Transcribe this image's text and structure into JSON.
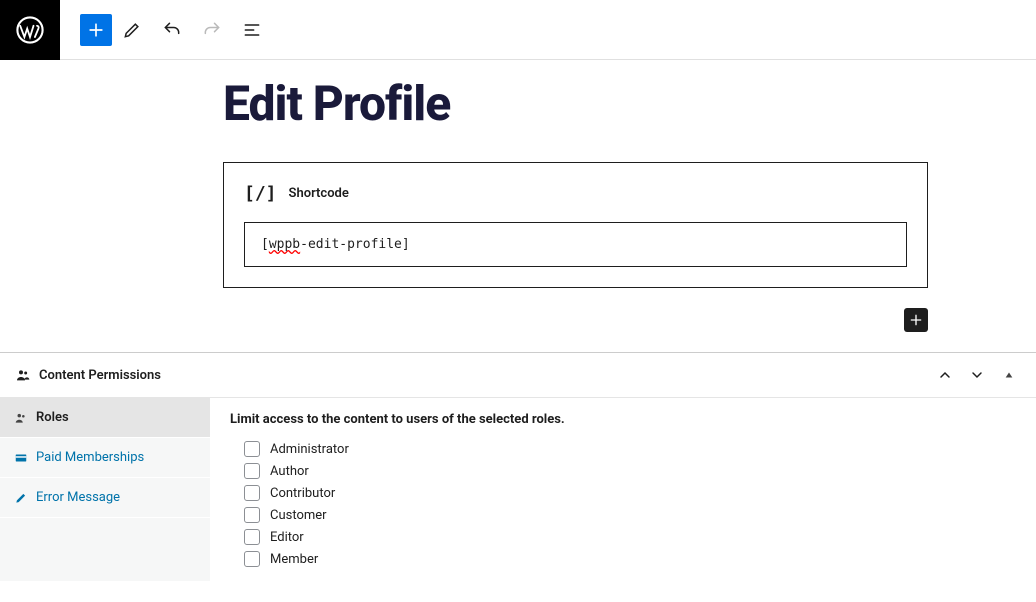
{
  "editor": {
    "page_title": "Edit Profile",
    "shortcode_block": {
      "label": "Shortcode",
      "value_prefix": "[",
      "value_spell": "wppb",
      "value_suffix": "-edit-profile]"
    }
  },
  "permissions": {
    "title": "Content Permissions",
    "sidebar": {
      "roles_label": "Roles",
      "paid_memberships_label": "Paid Memberships",
      "error_message_label": "Error Message"
    },
    "instruction": "Limit access to the content to users of the selected roles.",
    "roles": [
      "Administrator",
      "Author",
      "Contributor",
      "Customer",
      "Editor",
      "Member"
    ]
  }
}
